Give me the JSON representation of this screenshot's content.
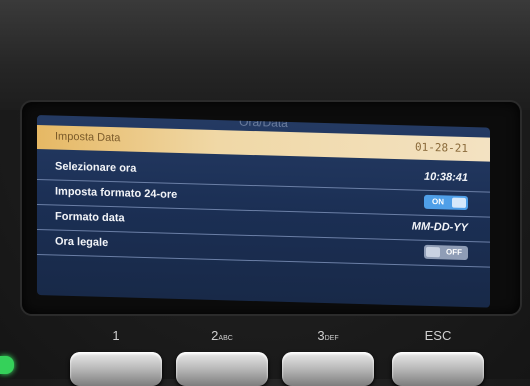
{
  "device": {
    "screen_title": "Ora/Data"
  },
  "settings": [
    {
      "label": "Imposta Data",
      "value": "01-28-21",
      "selected": true
    },
    {
      "label": "Selezionare ora",
      "value": "10:38:41"
    },
    {
      "label": "Imposta formato 24-ore",
      "toggle": "ON"
    },
    {
      "label": "Formato data",
      "value": "MM-DD-YY"
    },
    {
      "label": "Ora legale",
      "toggle": "OFF"
    }
  ],
  "keypad": {
    "keys": [
      {
        "number": "1",
        "letters": ""
      },
      {
        "number": "2",
        "letters": "ABC"
      },
      {
        "number": "3",
        "letters": "DEF"
      },
      {
        "number": "ESC",
        "letters": ""
      }
    ]
  },
  "colors": {
    "screen_bg": "#1b2f54",
    "highlight": "#f0d8a6",
    "toggle_on": "#4f9fe8",
    "toggle_off": "#8f9db6",
    "status_led": "#35d15a"
  }
}
